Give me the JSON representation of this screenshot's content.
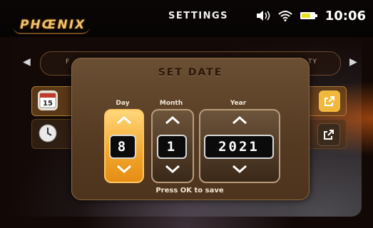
{
  "app": {
    "brand": "PHŒNIX",
    "title": "SETTINGS",
    "clock": "10:06",
    "status_icons": [
      "speaker-icon",
      "wifi-icon",
      "battery-icon"
    ],
    "accent": "#f2a52c"
  },
  "tabs": {
    "left_fragment": "F",
    "right_fragment": "TY"
  },
  "rows": [
    {
      "icon": "calendar-icon",
      "calendar_day": "15",
      "action_icon": "external-link-icon",
      "highlight": true
    },
    {
      "icon": "clock-icon",
      "action_icon": "external-link-icon",
      "highlight": false
    }
  ],
  "dialog": {
    "title": "SET DATE",
    "day": {
      "label": "Day",
      "value": "8"
    },
    "month": {
      "label": "Month",
      "value": "1"
    },
    "year": {
      "label": "Year",
      "value": "2021"
    },
    "hint": "Press OK to save"
  }
}
